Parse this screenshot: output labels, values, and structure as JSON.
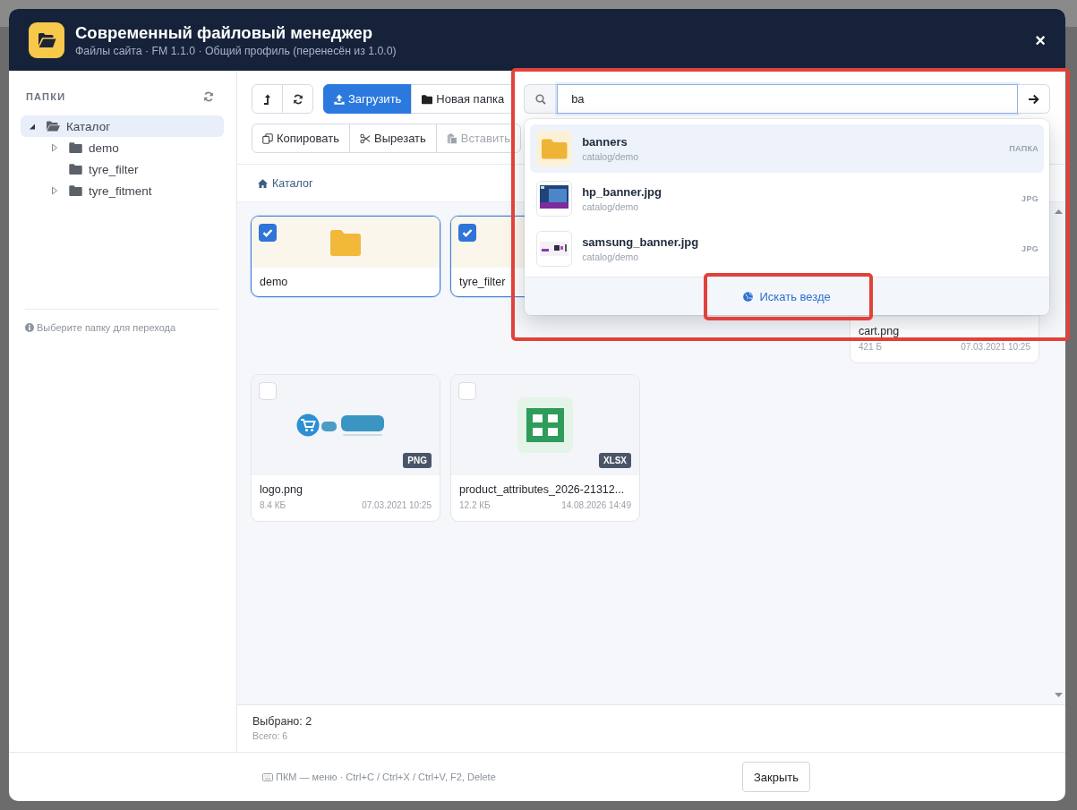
{
  "window": {
    "title": "Современный файловый менеджер",
    "subtitle": "Файлы сайта · FM 1.1.0 · Общий профиль (перенесён из 1.0.0)",
    "close": "×"
  },
  "sidebar": {
    "heading": "ПАПКИ",
    "tree": [
      {
        "kind": "branch",
        "label": "Каталог",
        "selected": true,
        "expanded": true,
        "children": [
          {
            "kind": "branch",
            "label": "demo",
            "selected": false,
            "expanded": false
          },
          {
            "kind": "leaf",
            "label": "tyre_filter",
            "selected": false,
            "expanded": false
          },
          {
            "kind": "branch",
            "label": "tyre_fitment",
            "selected": false,
            "expanded": false
          }
        ]
      }
    ],
    "hint": "Выберите папку для перехода"
  },
  "toolbar": {
    "nav_buttons": [
      {
        "kind": "up"
      },
      {
        "kind": "refresh"
      }
    ],
    "actions": [
      {
        "kind": "upload",
        "label": "Загрузить",
        "primary": true
      },
      {
        "kind": "new-folder",
        "label": "Новая папка",
        "primary": false
      }
    ],
    "edit_buttons": [
      {
        "kind": "copy",
        "label": "Копировать",
        "disabled": false
      },
      {
        "kind": "cut",
        "label": "Вырезать",
        "disabled": false
      },
      {
        "kind": "paste",
        "label": "Вставить",
        "disabled": true
      }
    ]
  },
  "search": {
    "value": "ba",
    "focused": true,
    "suggestions": [
      {
        "kind": "folder",
        "name": "banners",
        "path": "catalog/demo",
        "type": "ПАПКА",
        "selected": true
      },
      {
        "kind": "photo",
        "name": "hp_banner.jpg",
        "path": "catalog/demo",
        "type": "JPG",
        "selected": false
      },
      {
        "kind": "banner",
        "name": "samsung_banner.jpg",
        "path": "catalog/demo",
        "type": "JPG",
        "selected": false
      }
    ],
    "search_everywhere": "Искать везде"
  },
  "breadcrumb": [
    {
      "kind": "home",
      "label": "Каталог"
    }
  ],
  "files": [
    {
      "kind": "folder",
      "name": "demo",
      "checked": true,
      "thumbnail": true
    },
    {
      "kind": "folder",
      "name": "tyre_filter",
      "checked": true
    },
    {
      "kind": "image",
      "name": "cart.png",
      "size": "421 Б",
      "date": "07.03.2021 10:25"
    },
    {
      "kind": "image",
      "name": "logo.png",
      "size": "8.4 КБ",
      "date": "07.03.2021 10:25",
      "checked": false,
      "thumbnail": true,
      "type": "PNG"
    },
    {
      "kind": "spreadsheet",
      "name": "product_attributes_2026-21312...",
      "size": "12.2 КБ",
      "date": "14.08.2026 14:49",
      "checked": false,
      "thumbnail": true,
      "type": "XLSX"
    }
  ],
  "status": {
    "selected": "Выбрано: 2",
    "total": "Всего: 6"
  },
  "footer": {
    "hint": "ПКМ — меню · Ctrl+C / Ctrl+X / Ctrl+V, F2, Delete",
    "close_button": "Закрыть"
  }
}
